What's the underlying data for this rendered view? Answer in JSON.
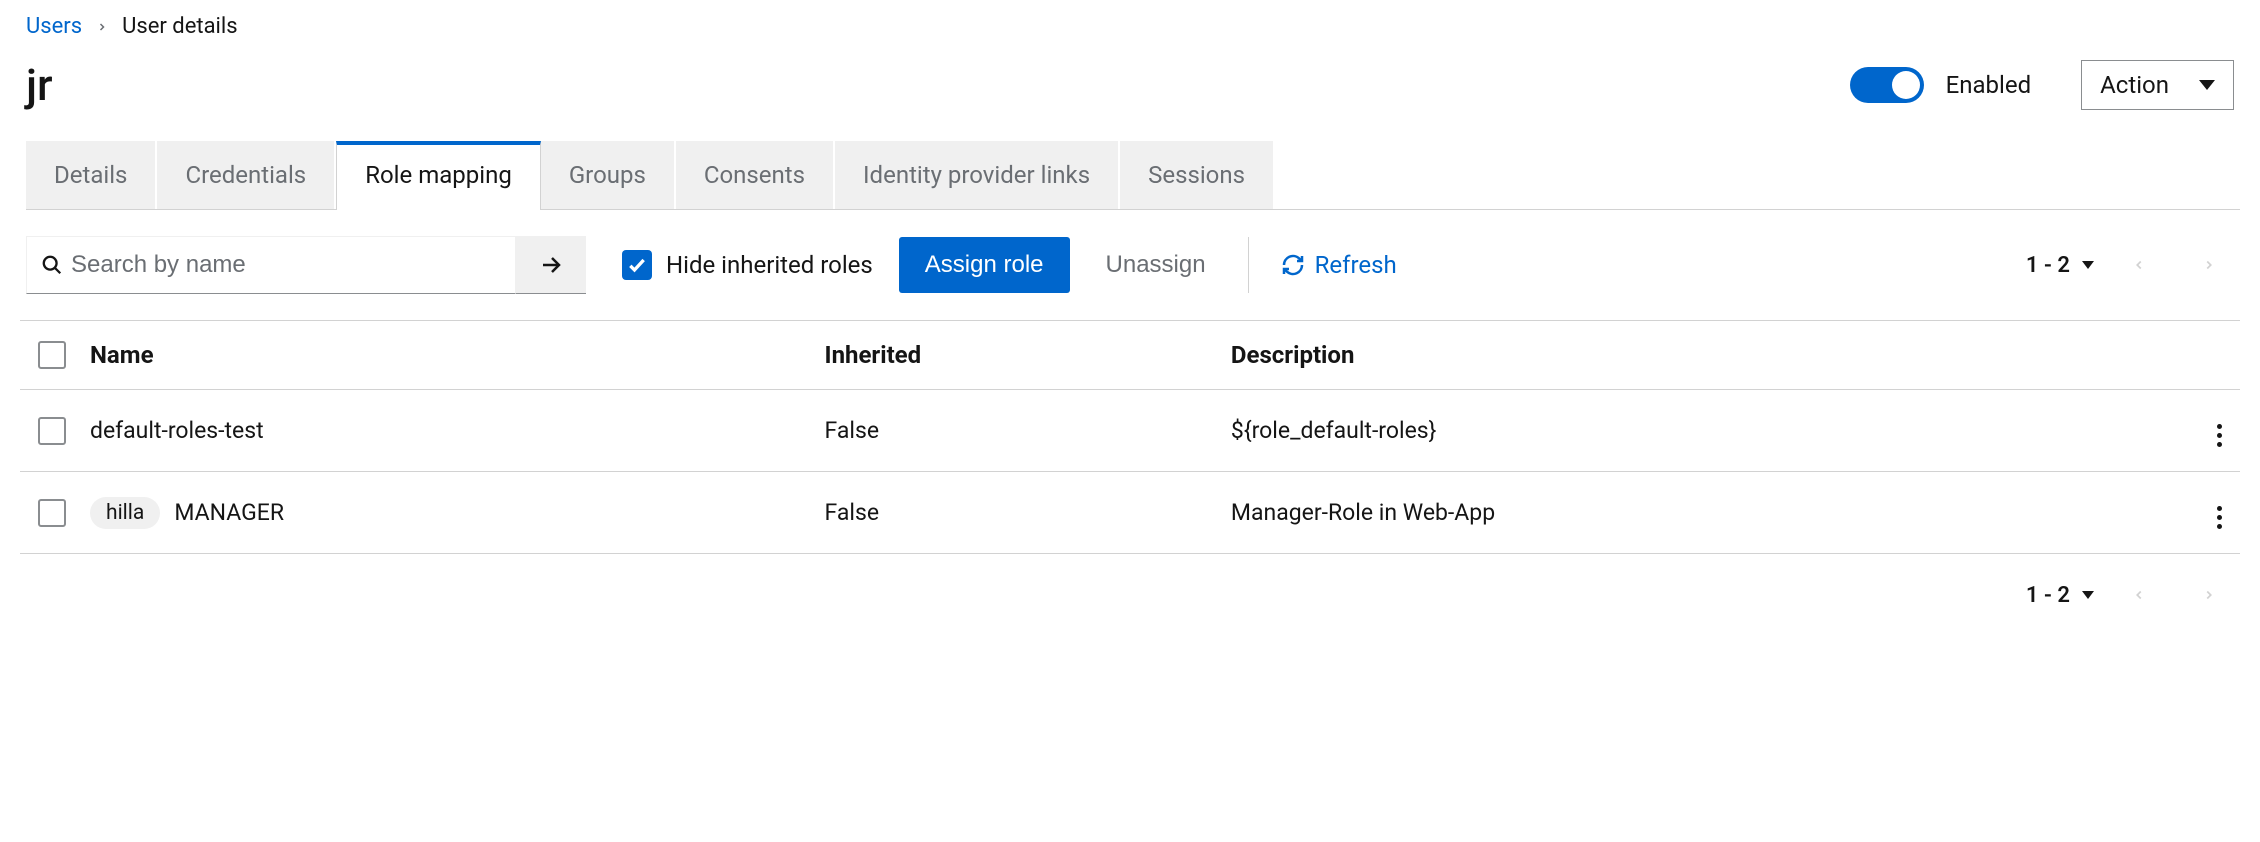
{
  "breadcrumb": {
    "root": "Users",
    "current": "User details"
  },
  "header": {
    "title": "jr",
    "enabled_label": "Enabled",
    "action_label": "Action"
  },
  "tabs": [
    {
      "label": "Details"
    },
    {
      "label": "Credentials"
    },
    {
      "label": "Role mapping"
    },
    {
      "label": "Groups"
    },
    {
      "label": "Consents"
    },
    {
      "label": "Identity provider links"
    },
    {
      "label": "Sessions"
    }
  ],
  "toolbar": {
    "search_placeholder": "Search by name",
    "hide_inherited_label": "Hide inherited roles",
    "assign_label": "Assign role",
    "unassign_label": "Unassign",
    "refresh_label": "Refresh",
    "page_range": "1 - 2"
  },
  "table": {
    "headers": {
      "name": "Name",
      "inherited": "Inherited",
      "description": "Description"
    },
    "rows": [
      {
        "badge": "",
        "name": "default-roles-test",
        "inherited": "False",
        "description": "${role_default-roles}"
      },
      {
        "badge": "hilla",
        "name": "MANAGER",
        "inherited": "False",
        "description": "Manager-Role in Web-App"
      }
    ]
  },
  "footer": {
    "page_range": "1 - 2"
  }
}
